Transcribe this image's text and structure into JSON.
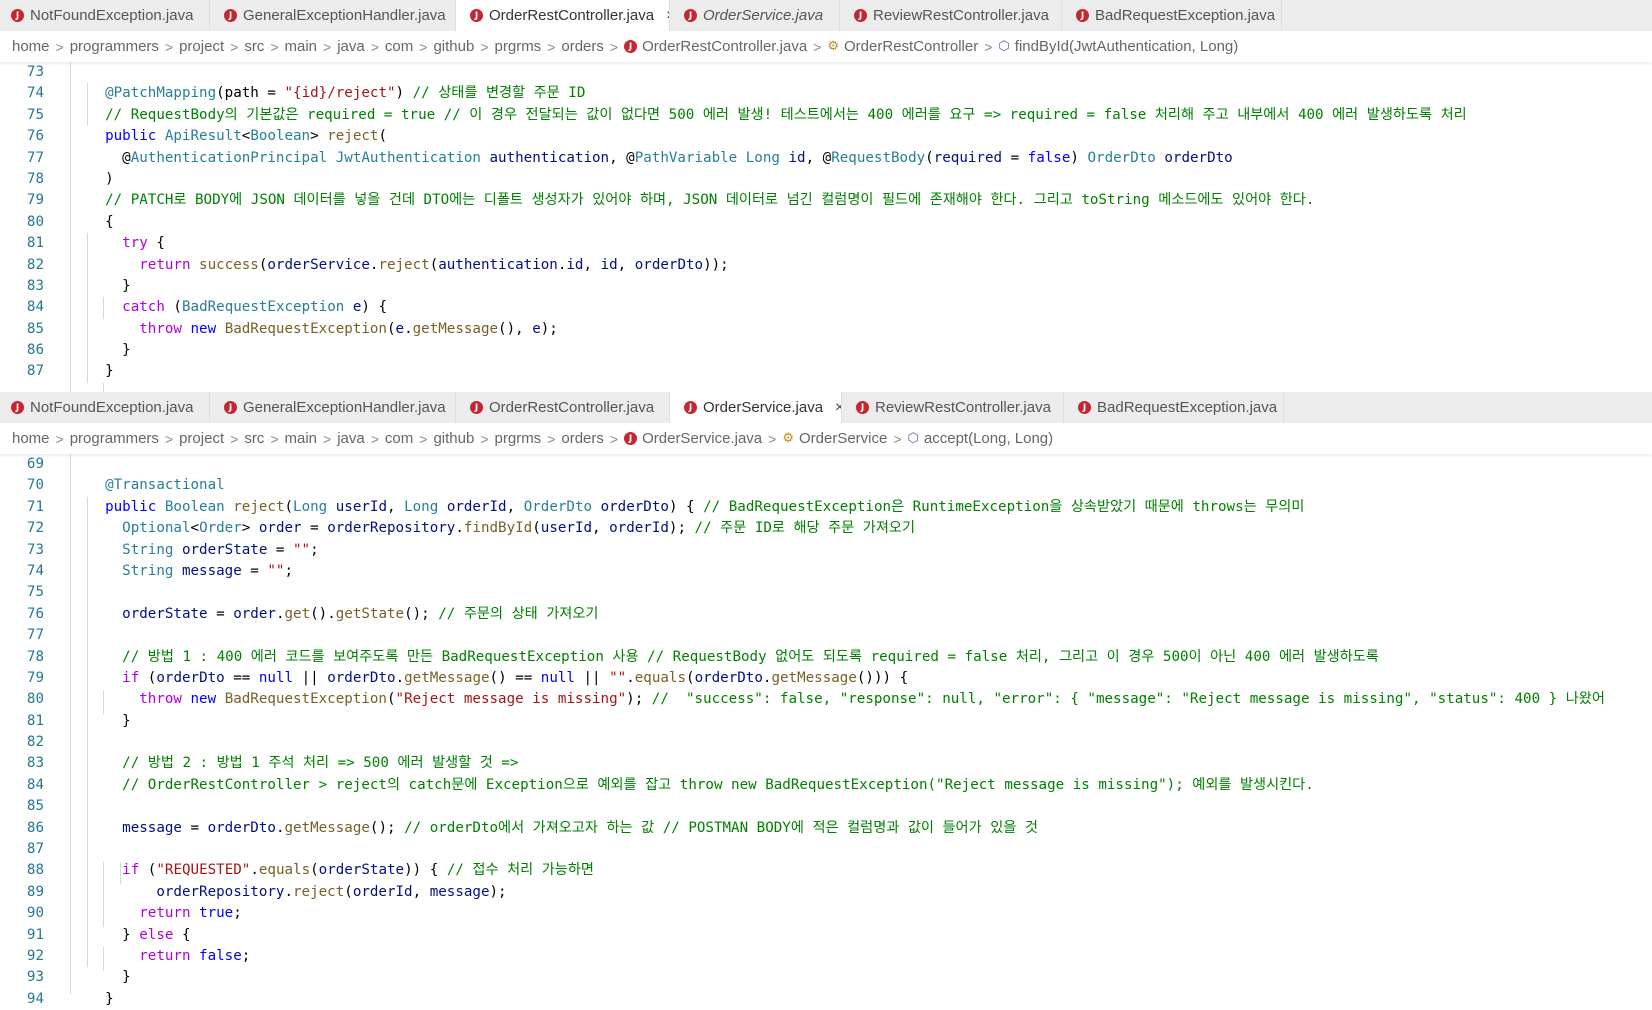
{
  "tabs_top": [
    {
      "label": "NotFoundException.java",
      "active": false,
      "italic": false
    },
    {
      "label": "GeneralExceptionHandler.java",
      "active": false,
      "italic": false
    },
    {
      "label": "OrderRestController.java",
      "active": true,
      "italic": false
    },
    {
      "label": "OrderService.java",
      "active": false,
      "italic": true
    },
    {
      "label": "ReviewRestController.java",
      "active": false,
      "italic": false
    },
    {
      "label": "BadRequestException.java",
      "active": false,
      "italic": false
    }
  ],
  "tabs_bottom": [
    {
      "label": "NotFoundException.java",
      "active": false,
      "italic": false
    },
    {
      "label": "GeneralExceptionHandler.java",
      "active": false,
      "italic": false
    },
    {
      "label": "OrderRestController.java",
      "active": false,
      "italic": false
    },
    {
      "label": "OrderService.java",
      "active": true,
      "italic": false
    },
    {
      "label": "ReviewRestController.java",
      "active": false,
      "italic": false
    },
    {
      "label": "BadRequestException.java",
      "active": false,
      "italic": false
    }
  ],
  "close_glyph": "×",
  "java_glyph": "J",
  "sep_glyph": ">",
  "breadcrumb_top": {
    "folders": [
      "home",
      "programmers",
      "project",
      "src",
      "main",
      "java",
      "com",
      "github",
      "prgrms",
      "orders"
    ],
    "file": "OrderRestController.java",
    "class_name": "OrderRestController",
    "method": "findById(JwtAuthentication, Long)"
  },
  "breadcrumb_bottom": {
    "folders": [
      "home",
      "programmers",
      "project",
      "src",
      "main",
      "java",
      "com",
      "github",
      "prgrms",
      "orders"
    ],
    "file": "OrderService.java",
    "class_name": "OrderService",
    "method": "accept(Long, Long)"
  },
  "code_top": [
    {
      "n": "73",
      "t": [
        [
          "p",
          ""
        ]
      ]
    },
    {
      "n": "74",
      "t": [
        [
          "p",
          "  "
        ],
        [
          "an",
          "@PatchMapping"
        ],
        [
          "p",
          "(path = "
        ],
        [
          "s",
          "\"{id}/reject\""
        ],
        [
          "p",
          ") "
        ],
        [
          "c",
          "// 상태를 변경할 주문 ID"
        ]
      ]
    },
    {
      "n": "75",
      "t": [
        [
          "p",
          "  "
        ],
        [
          "c",
          "// RequestBody의 기본값은 required = true // 이 경우 전달되는 값이 없다면 500 에러 발생! 테스트에서는 400 에러를 요구 => required = false 처리해 주고 내부에서 400 에러 발생하도록 처리"
        ]
      ]
    },
    {
      "n": "76",
      "t": [
        [
          "p",
          "  "
        ],
        [
          "k",
          "public"
        ],
        [
          "p",
          " "
        ],
        [
          "ty",
          "ApiResult"
        ],
        [
          "p",
          "<"
        ],
        [
          "ty",
          "Boolean"
        ],
        [
          "p",
          "> "
        ],
        [
          "fn",
          "reject"
        ],
        [
          "p",
          "("
        ]
      ]
    },
    {
      "n": "77",
      "t": [
        [
          "p",
          "    @"
        ],
        [
          "an",
          "AuthenticationPrincipal"
        ],
        [
          "p",
          " "
        ],
        [
          "ty",
          "JwtAuthentication"
        ],
        [
          "p",
          " "
        ],
        [
          "v",
          "authentication"
        ],
        [
          "p",
          ", @"
        ],
        [
          "an",
          "PathVariable"
        ],
        [
          "p",
          " "
        ],
        [
          "ty",
          "Long"
        ],
        [
          "p",
          " "
        ],
        [
          "v",
          "id"
        ],
        [
          "p",
          ", @"
        ],
        [
          "an",
          "RequestBody"
        ],
        [
          "p",
          "("
        ],
        [
          "v",
          "required"
        ],
        [
          "p",
          " = "
        ],
        [
          "k",
          "false"
        ],
        [
          "p",
          ") "
        ],
        [
          "ty",
          "OrderDto"
        ],
        [
          "p",
          " "
        ],
        [
          "v",
          "orderDto"
        ]
      ]
    },
    {
      "n": "78",
      "t": [
        [
          "p",
          "  )"
        ]
      ]
    },
    {
      "n": "79",
      "t": [
        [
          "p",
          "  "
        ],
        [
          "c",
          "// PATCH로 BODY에 JSON 데이터를 넣을 건데 DTO에는 디폴트 생성자가 있어야 하며, JSON 데이터로 넘긴 컬럼명이 필드에 존재해야 한다. 그리고 toString 메소드에도 있어야 한다."
        ]
      ]
    },
    {
      "n": "80",
      "t": [
        [
          "p",
          "  {"
        ]
      ]
    },
    {
      "n": "81",
      "t": [
        [
          "p",
          "    "
        ],
        [
          "kc",
          "try"
        ],
        [
          "p",
          " {"
        ]
      ]
    },
    {
      "n": "82",
      "t": [
        [
          "p",
          "      "
        ],
        [
          "kc",
          "return"
        ],
        [
          "p",
          " "
        ],
        [
          "fn",
          "success"
        ],
        [
          "p",
          "("
        ],
        [
          "v",
          "orderService"
        ],
        [
          "p",
          "."
        ],
        [
          "fn",
          "reject"
        ],
        [
          "p",
          "("
        ],
        [
          "v",
          "authentication"
        ],
        [
          "p",
          "."
        ],
        [
          "v",
          "id"
        ],
        [
          "p",
          ", "
        ],
        [
          "v",
          "id"
        ],
        [
          "p",
          ", "
        ],
        [
          "v",
          "orderDto"
        ],
        [
          "p",
          "));"
        ]
      ]
    },
    {
      "n": "83",
      "t": [
        [
          "p",
          "    }"
        ]
      ]
    },
    {
      "n": "84",
      "t": [
        [
          "p",
          "    "
        ],
        [
          "kc",
          "catch"
        ],
        [
          "p",
          " ("
        ],
        [
          "ty",
          "BadRequestException"
        ],
        [
          "p",
          " "
        ],
        [
          "v",
          "e"
        ],
        [
          "p",
          ") {"
        ]
      ]
    },
    {
      "n": "85",
      "t": [
        [
          "p",
          "      "
        ],
        [
          "kc",
          "throw"
        ],
        [
          "p",
          " "
        ],
        [
          "k",
          "new"
        ],
        [
          "p",
          " "
        ],
        [
          "fn",
          "BadRequestException"
        ],
        [
          "p",
          "("
        ],
        [
          "v",
          "e"
        ],
        [
          "p",
          "."
        ],
        [
          "fn",
          "getMessage"
        ],
        [
          "p",
          "(), "
        ],
        [
          "v",
          "e"
        ],
        [
          "p",
          ");"
        ]
      ]
    },
    {
      "n": "86",
      "t": [
        [
          "p",
          "    }"
        ]
      ]
    },
    {
      "n": "87",
      "t": [
        [
          "p",
          "  }"
        ]
      ]
    }
  ],
  "code_bottom": [
    {
      "n": "69",
      "t": [
        [
          "p",
          ""
        ]
      ]
    },
    {
      "n": "70",
      "t": [
        [
          "p",
          "  "
        ],
        [
          "an",
          "@Transactional"
        ]
      ]
    },
    {
      "n": "71",
      "t": [
        [
          "p",
          "  "
        ],
        [
          "k",
          "public"
        ],
        [
          "p",
          " "
        ],
        [
          "ty",
          "Boolean"
        ],
        [
          "p",
          " "
        ],
        [
          "fn",
          "reject"
        ],
        [
          "p",
          "("
        ],
        [
          "ty",
          "Long"
        ],
        [
          "p",
          " "
        ],
        [
          "v",
          "userId"
        ],
        [
          "p",
          ", "
        ],
        [
          "ty",
          "Long"
        ],
        [
          "p",
          " "
        ],
        [
          "v",
          "orderId"
        ],
        [
          "p",
          ", "
        ],
        [
          "ty",
          "OrderDto"
        ],
        [
          "p",
          " "
        ],
        [
          "v",
          "orderDto"
        ],
        [
          "p",
          ") { "
        ],
        [
          "c",
          "// BadRequestException은 RuntimeException을 상속받았기 때문에 throws는 무의미"
        ]
      ]
    },
    {
      "n": "72",
      "t": [
        [
          "p",
          "    "
        ],
        [
          "ty",
          "Optional"
        ],
        [
          "p",
          "<"
        ],
        [
          "ty",
          "Order"
        ],
        [
          "p",
          "> "
        ],
        [
          "v",
          "order"
        ],
        [
          "p",
          " = "
        ],
        [
          "v",
          "orderRepository"
        ],
        [
          "p",
          "."
        ],
        [
          "fn",
          "findById"
        ],
        [
          "p",
          "("
        ],
        [
          "v",
          "userId"
        ],
        [
          "p",
          ", "
        ],
        [
          "v",
          "orderId"
        ],
        [
          "p",
          "); "
        ],
        [
          "c",
          "// 주문 ID로 해당 주문 가져오기"
        ]
      ]
    },
    {
      "n": "73",
      "t": [
        [
          "p",
          "    "
        ],
        [
          "ty",
          "String"
        ],
        [
          "p",
          " "
        ],
        [
          "v",
          "orderState"
        ],
        [
          "p",
          " = "
        ],
        [
          "s",
          "\"\""
        ],
        [
          "p",
          ";"
        ]
      ]
    },
    {
      "n": "74",
      "t": [
        [
          "p",
          "    "
        ],
        [
          "ty",
          "String"
        ],
        [
          "p",
          " "
        ],
        [
          "v",
          "message"
        ],
        [
          "p",
          " = "
        ],
        [
          "s",
          "\"\""
        ],
        [
          "p",
          ";"
        ]
      ]
    },
    {
      "n": "75",
      "t": [
        [
          "p",
          ""
        ]
      ]
    },
    {
      "n": "76",
      "t": [
        [
          "p",
          "    "
        ],
        [
          "v",
          "orderState"
        ],
        [
          "p",
          " = "
        ],
        [
          "v",
          "order"
        ],
        [
          "p",
          "."
        ],
        [
          "fn",
          "get"
        ],
        [
          "p",
          "()."
        ],
        [
          "fn",
          "getState"
        ],
        [
          "p",
          "(); "
        ],
        [
          "c",
          "// 주문의 상태 가져오기"
        ]
      ]
    },
    {
      "n": "77",
      "t": [
        [
          "p",
          ""
        ]
      ]
    },
    {
      "n": "78",
      "t": [
        [
          "p",
          "    "
        ],
        [
          "c",
          "// 방법 1 : 400 에러 코드를 보여주도록 만든 BadRequestException 사용 // RequestBody 없어도 되도록 required = false 처리, 그리고 이 경우 500이 아닌 400 에러 발생하도록"
        ]
      ]
    },
    {
      "n": "79",
      "t": [
        [
          "p",
          "    "
        ],
        [
          "kc",
          "if"
        ],
        [
          "p",
          " ("
        ],
        [
          "v",
          "orderDto"
        ],
        [
          "p",
          " == "
        ],
        [
          "k",
          "null"
        ],
        [
          "p",
          " || "
        ],
        [
          "v",
          "orderDto"
        ],
        [
          "p",
          "."
        ],
        [
          "fn",
          "getMessage"
        ],
        [
          "p",
          "() == "
        ],
        [
          "k",
          "null"
        ],
        [
          "p",
          " || "
        ],
        [
          "s",
          "\"\""
        ],
        [
          "p",
          "."
        ],
        [
          "fn",
          "equals"
        ],
        [
          "p",
          "("
        ],
        [
          "v",
          "orderDto"
        ],
        [
          "p",
          "."
        ],
        [
          "fn",
          "getMessage"
        ],
        [
          "p",
          "())) {"
        ]
      ]
    },
    {
      "n": "80",
      "t": [
        [
          "p",
          "      "
        ],
        [
          "kc",
          "throw"
        ],
        [
          "p",
          " "
        ],
        [
          "k",
          "new"
        ],
        [
          "p",
          " "
        ],
        [
          "fn",
          "BadRequestException"
        ],
        [
          "p",
          "("
        ],
        [
          "s",
          "\"Reject message is missing\""
        ],
        [
          "p",
          "); "
        ],
        [
          "c",
          "//  \"success\": false, \"response\": null, \"error\": { \"message\": \"Reject message is missing\", \"status\": 400 } 나왔어"
        ]
      ]
    },
    {
      "n": "81",
      "t": [
        [
          "p",
          "    }"
        ]
      ]
    },
    {
      "n": "82",
      "t": [
        [
          "p",
          ""
        ]
      ]
    },
    {
      "n": "83",
      "t": [
        [
          "p",
          "    "
        ],
        [
          "c",
          "// 방법 2 : 방법 1 주석 처리 => 500 에러 발생할 것 =>"
        ]
      ]
    },
    {
      "n": "84",
      "t": [
        [
          "p",
          "    "
        ],
        [
          "c",
          "// OrderRestController > reject의 catch문에 Exception으로 예외를 잡고 throw new BadRequestException(\"Reject message is missing\"); 예외를 발생시킨다."
        ]
      ]
    },
    {
      "n": "85",
      "t": [
        [
          "p",
          ""
        ]
      ]
    },
    {
      "n": "86",
      "t": [
        [
          "p",
          "    "
        ],
        [
          "v",
          "message"
        ],
        [
          "p",
          " = "
        ],
        [
          "v",
          "orderDto"
        ],
        [
          "p",
          "."
        ],
        [
          "fn",
          "getMessage"
        ],
        [
          "p",
          "(); "
        ],
        [
          "c",
          "// orderDto에서 가져오고자 하는 값 // POSTMAN BODY에 적은 컬럼명과 값이 들어가 있을 것"
        ]
      ]
    },
    {
      "n": "87",
      "t": [
        [
          "p",
          ""
        ]
      ]
    },
    {
      "n": "88",
      "t": [
        [
          "p",
          "    "
        ],
        [
          "kc",
          "if"
        ],
        [
          "p",
          " ("
        ],
        [
          "s",
          "\"REQUESTED\""
        ],
        [
          "p",
          "."
        ],
        [
          "fn",
          "equals"
        ],
        [
          "p",
          "("
        ],
        [
          "v",
          "orderState"
        ],
        [
          "p",
          ")) { "
        ],
        [
          "c",
          "// 접수 처리 가능하면"
        ]
      ]
    },
    {
      "n": "89",
      "t": [
        [
          "p",
          "        "
        ],
        [
          "v",
          "orderRepository"
        ],
        [
          "p",
          "."
        ],
        [
          "fn",
          "reject"
        ],
        [
          "p",
          "("
        ],
        [
          "v",
          "orderId"
        ],
        [
          "p",
          ", "
        ],
        [
          "v",
          "message"
        ],
        [
          "p",
          ");"
        ]
      ]
    },
    {
      "n": "90",
      "t": [
        [
          "p",
          "      "
        ],
        [
          "kc",
          "return"
        ],
        [
          "p",
          " "
        ],
        [
          "k",
          "true"
        ],
        [
          "p",
          ";"
        ]
      ]
    },
    {
      "n": "91",
      "t": [
        [
          "p",
          "    } "
        ],
        [
          "kc",
          "else"
        ],
        [
          "p",
          " {"
        ]
      ]
    },
    {
      "n": "92",
      "t": [
        [
          "p",
          "      "
        ],
        [
          "kc",
          "return"
        ],
        [
          "p",
          " "
        ],
        [
          "k",
          "false"
        ],
        [
          "p",
          ";"
        ]
      ]
    },
    {
      "n": "93",
      "t": [
        [
          "p",
          "    }"
        ]
      ]
    },
    {
      "n": "94",
      "t": [
        [
          "p",
          "  }"
        ]
      ]
    }
  ]
}
